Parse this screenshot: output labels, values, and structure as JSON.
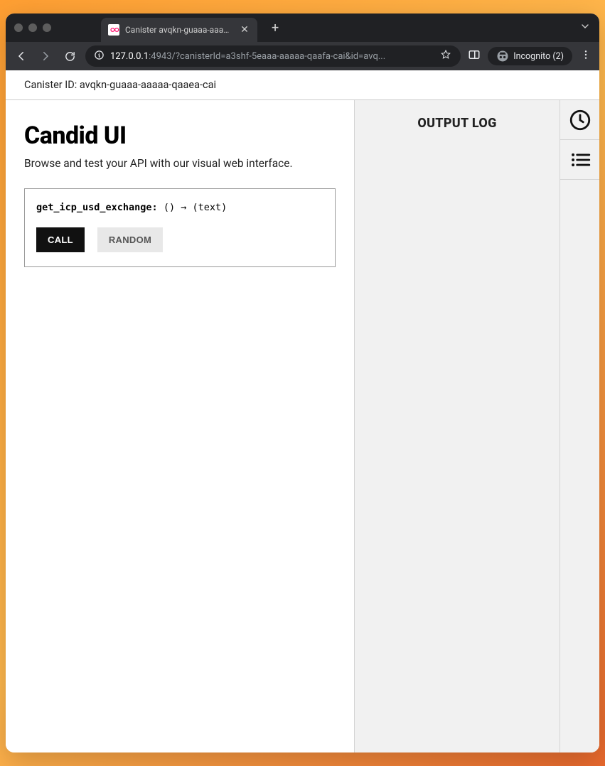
{
  "browser": {
    "tab_title": "Canister avqkn-guaaa-aaaaa-q",
    "new_tab": "+",
    "url_host": "127.0.0.1",
    "url_rest": ":4943/?canisterId=a3shf-5eaaa-aaaaa-qaafa-cai&id=avq...",
    "incognito_label": "Incognito (2)"
  },
  "canister_bar": {
    "label": "Canister ID: avqkn-guaaa-aaaaa-qaaea-cai"
  },
  "main": {
    "title": "Candid UI",
    "subtitle": "Browse and test your API with our visual web interface.",
    "method": {
      "name": "get_icp_usd_exchange:",
      "sig": " () → (text)"
    },
    "buttons": {
      "call": "CALL",
      "random": "RANDOM"
    }
  },
  "output": {
    "title": "OUTPUT LOG"
  },
  "icons": {
    "clock": "clock-icon",
    "list": "list-icon"
  }
}
